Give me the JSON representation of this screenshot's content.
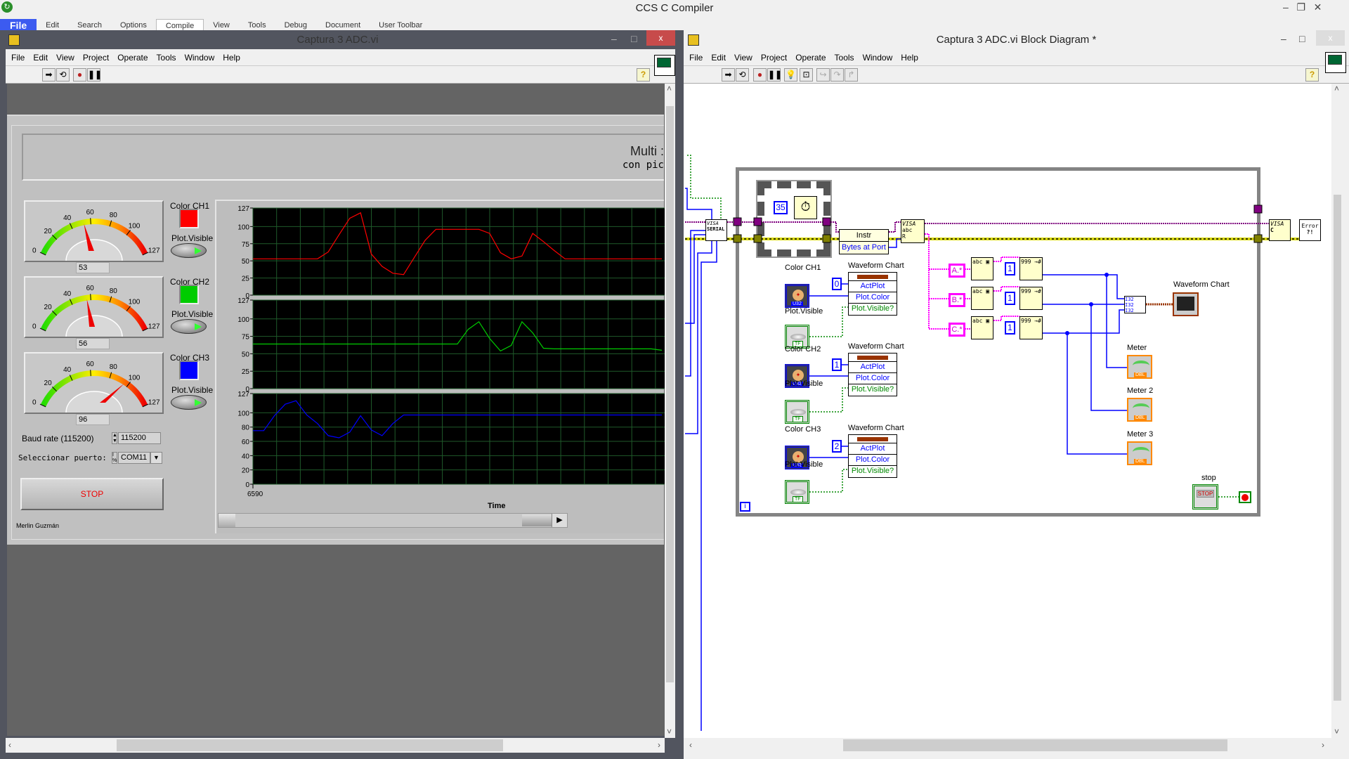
{
  "ccs": {
    "title": "CCS C Compiler",
    "menu": [
      "File",
      "Edit",
      "Search",
      "Options",
      "Compile",
      "View",
      "Tools",
      "Debug",
      "Document",
      "User Toolbar"
    ]
  },
  "front_panel": {
    "title": "Captura 3 ADC.vi",
    "menu": [
      "File",
      "Edit",
      "View",
      "Project",
      "Operate",
      "Tools",
      "Window",
      "Help"
    ],
    "header_line1": "Multi :",
    "header_line2": "con pic",
    "gauges": [
      {
        "value": 53,
        "display": "53",
        "min": 0,
        "max": 127,
        "ticks": [
          "0",
          "20",
          "40",
          "60",
          "80",
          "100",
          "127"
        ]
      },
      {
        "value": 56,
        "display": "56",
        "min": 0,
        "max": 127,
        "ticks": [
          "0",
          "20",
          "40",
          "60",
          "80",
          "100",
          "127"
        ]
      },
      {
        "value": 96,
        "display": "96",
        "min": 0,
        "max": 127,
        "ticks": [
          "0",
          "20",
          "40",
          "60",
          "80",
          "100",
          "127"
        ]
      }
    ],
    "channels": [
      {
        "color_label": "Color CH1",
        "color": "#ff0000",
        "visible_label": "Plot.Visible",
        "visible": true
      },
      {
        "color_label": "Color CH2",
        "color": "#00cc00",
        "visible_label": "Plot.Visible",
        "visible": true
      },
      {
        "color_label": "Color CH3",
        "color": "#0000ff",
        "visible_label": "Plot.Visible",
        "visible": true
      }
    ],
    "baud_label": "Baud rate (115200)",
    "baud_value": "115200",
    "port_label": "Seleccionar puerto:",
    "port_value": "COM11",
    "stop_label": "STOP",
    "author": "Merlin Guzmán"
  },
  "chart_data": {
    "type": "line",
    "xlabel": "Time",
    "x_start_label": "6590",
    "grid": true,
    "background": "#000000",
    "grid_color": "#1f5a2a",
    "plots": [
      {
        "color": "#ff0000",
        "ylim": [
          0,
          127
        ],
        "yticks": [
          0,
          25,
          50,
          75,
          100,
          127
        ],
        "values": [
          53,
          53,
          53,
          53,
          53,
          53,
          53,
          63,
          88,
          112,
          120,
          60,
          42,
          32,
          30,
          55,
          80,
          96,
          96,
          96,
          96,
          96,
          90,
          62,
          53,
          57,
          90,
          78,
          65,
          53,
          53,
          53,
          53,
          53,
          53,
          53,
          53,
          53,
          53
        ]
      },
      {
        "color": "#00cc00",
        "ylim": [
          0,
          127
        ],
        "yticks": [
          0,
          25,
          50,
          75,
          100,
          127
        ],
        "values": [
          64,
          64,
          64,
          64,
          64,
          64,
          64,
          64,
          64,
          64,
          64,
          64,
          64,
          64,
          64,
          64,
          64,
          64,
          64,
          64,
          85,
          96,
          72,
          54,
          62,
          96,
          80,
          58,
          57,
          57,
          57,
          57,
          57,
          57,
          57,
          57,
          57,
          57,
          55
        ]
      },
      {
        "color": "#0000ff",
        "ylim": [
          0,
          127
        ],
        "yticks": [
          0,
          20,
          40,
          60,
          80,
          100,
          127
        ],
        "values": [
          75,
          75,
          96,
          112,
          117,
          97,
          85,
          68,
          65,
          73,
          96,
          76,
          68,
          85,
          97,
          97,
          97,
          97,
          97,
          97,
          97,
          97,
          97,
          97,
          97,
          97,
          97,
          97,
          97,
          97,
          97,
          97,
          97,
          97,
          97,
          97,
          97,
          97,
          97
        ]
      }
    ]
  },
  "block_diagram": {
    "title": "Captura 3 ADC.vi Block Diagram *",
    "menu": [
      "File",
      "Edit",
      "View",
      "Project",
      "Operate",
      "Tools",
      "Window",
      "Help"
    ],
    "wait_ms": "35",
    "visa_serial": [
      "VISA",
      "SERIAL"
    ],
    "property_instr": {
      "class": "Instr",
      "prop": "Bytes at Port"
    },
    "visa_read": "VISA",
    "visa_close": "VISA",
    "error_out": "Error",
    "patterns": [
      "A.*",
      "B.*",
      "C.*"
    ],
    "offset_consts": [
      "1",
      "1",
      "1"
    ],
    "chart_nodes": [
      {
        "label": "Waveform Chart",
        "plot_index": "0",
        "rows": [
          "ActPlot",
          "Plot.Color",
          "Plot.Visible?"
        ]
      },
      {
        "label": "Waveform Chart",
        "plot_index": "1",
        "rows": [
          "ActPlot",
          "Plot.Color",
          "Plot.Visible?"
        ]
      },
      {
        "label": "Waveform Chart",
        "plot_index": "2",
        "rows": [
          "ActPlot",
          "Plot.Color",
          "Plot.Visible?"
        ]
      }
    ],
    "controls": [
      {
        "color_label": "Color CH1",
        "visible_label": "Plot.Visible"
      },
      {
        "color_label": "Color CH2",
        "visible_label": "Plot.Visible"
      },
      {
        "color_label": "Color CH3",
        "visible_label": "Plot.Visible"
      }
    ],
    "terminal_types": {
      "color": "U32",
      "bool": "TF",
      "meter": "DBL",
      "array": "I32"
    },
    "chart_terminal_label": "Waveform Chart",
    "meters": [
      "Meter",
      "Meter 2",
      "Meter 3"
    ],
    "stop_label": "stop",
    "stop_text": "STOP",
    "iteration": "i"
  }
}
